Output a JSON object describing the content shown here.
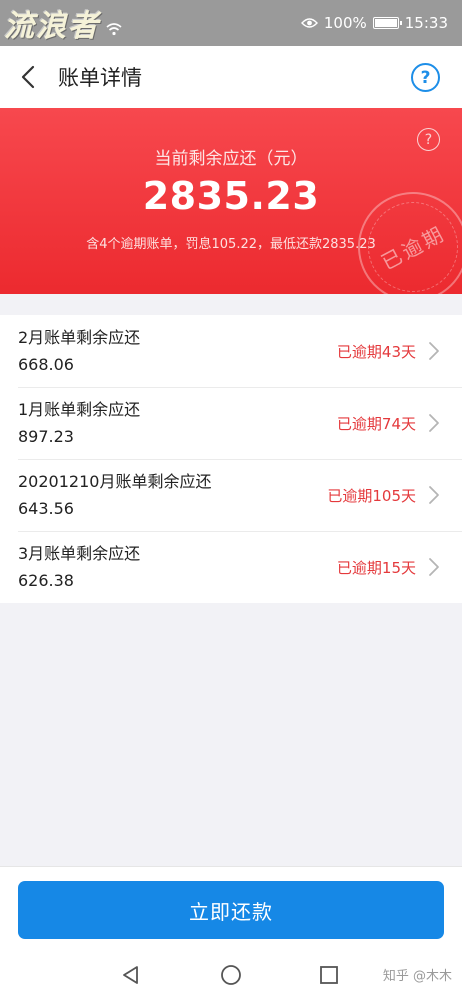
{
  "status_bar": {
    "logo_text": "流浪者",
    "battery": "100%",
    "time": "15:33"
  },
  "header": {
    "title": "账单详情",
    "help": "?"
  },
  "summary": {
    "label": "当前剩余应还（元）",
    "amount": "2835.23",
    "note": "含4个逾期账单，罚息105.22，最低还款2835.23",
    "help": "?",
    "stamp": "已逾期"
  },
  "bills": [
    {
      "title": "2月账单剩余应还",
      "amount": "668.06",
      "status": "已逾期43天"
    },
    {
      "title": "1月账单剩余应还",
      "amount": "897.23",
      "status": "已逾期74天"
    },
    {
      "title": "20201210月账单剩余应还",
      "amount": "643.56",
      "status": "已逾期105天"
    },
    {
      "title": "3月账单剩余应还",
      "amount": "626.38",
      "status": "已逾期15天"
    }
  ],
  "actions": {
    "pay_label": "立即还款"
  },
  "watermark": {
    "text": "知乎 @木木"
  },
  "colors": {
    "accent_blue": "#1688e6",
    "overdue_red": "#e4393c",
    "banner_red": "#ec2a2f"
  }
}
